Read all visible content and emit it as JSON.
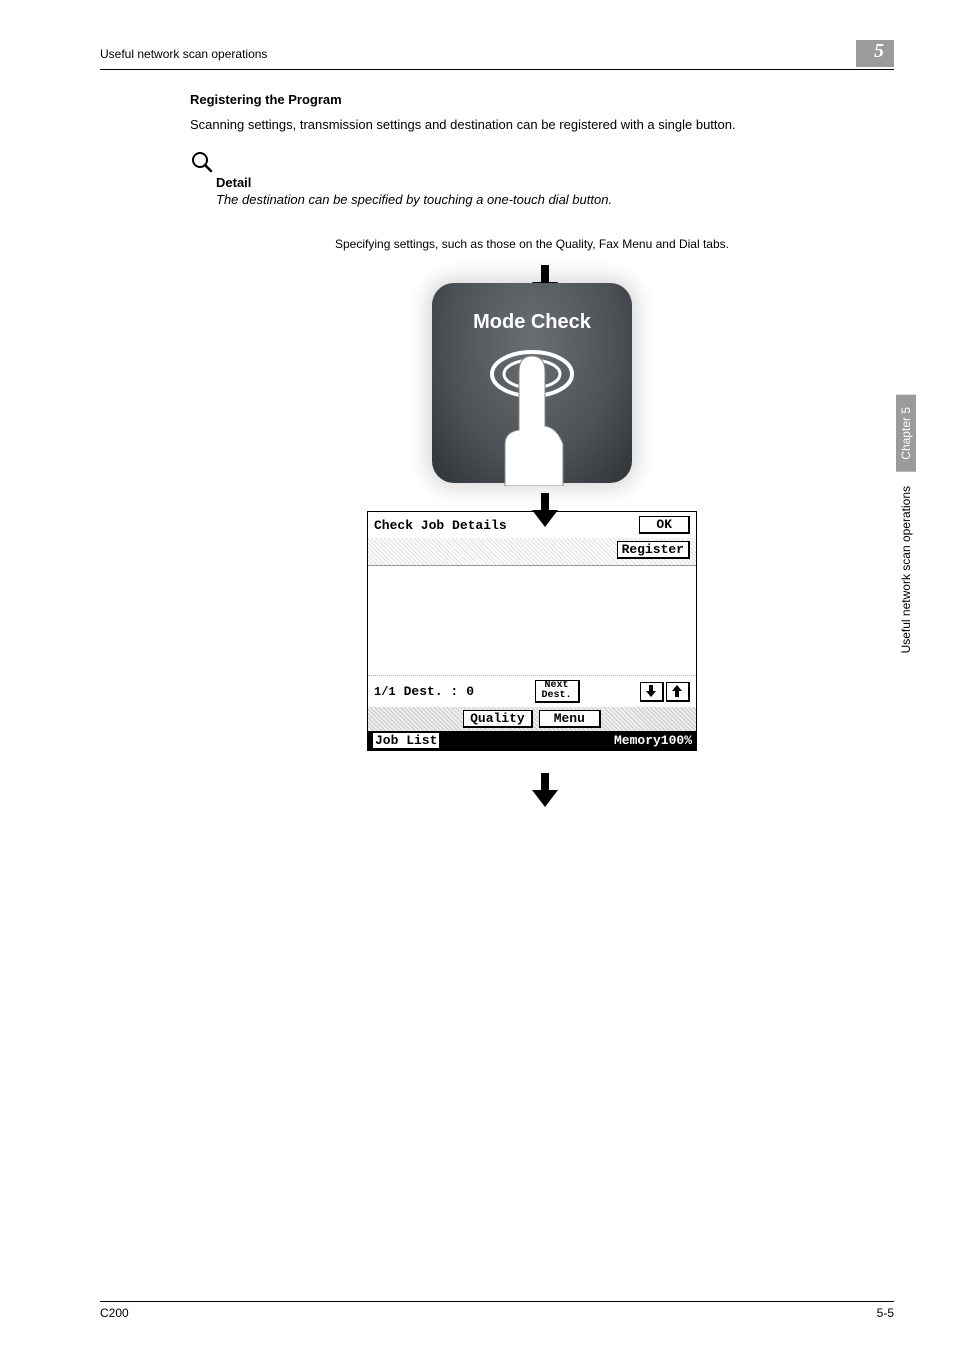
{
  "header": {
    "left": "Useful network scan operations",
    "badge": "5"
  },
  "section": {
    "heading": "Registering the Program",
    "body": "Scanning settings, transmission settings and destination can be registered with a single button.",
    "detail_label": "Detail",
    "detail_text": "The destination can be specified by touching a one-touch dial button."
  },
  "flow": {
    "caption": "Specifying settings, such as those on the Quality, Fax Menu and Dial tabs.",
    "mode_check_label": "Mode Check"
  },
  "lcd": {
    "title": "Check Job Details",
    "ok": "OK",
    "register": "Register",
    "dest_frac": "1/1",
    "dest_label": "Dest. :",
    "dest_value": "0",
    "next_dest_l1": "Next",
    "next_dest_l2": "Dest.",
    "tab_quality": "Quality",
    "tab_menu": "Menu",
    "job_list": "Job List",
    "memory": "Memory100%"
  },
  "side": {
    "chapter": "Chapter 5",
    "text": "Useful network scan operations"
  },
  "footer": {
    "left": "C200",
    "right": "5-5"
  }
}
